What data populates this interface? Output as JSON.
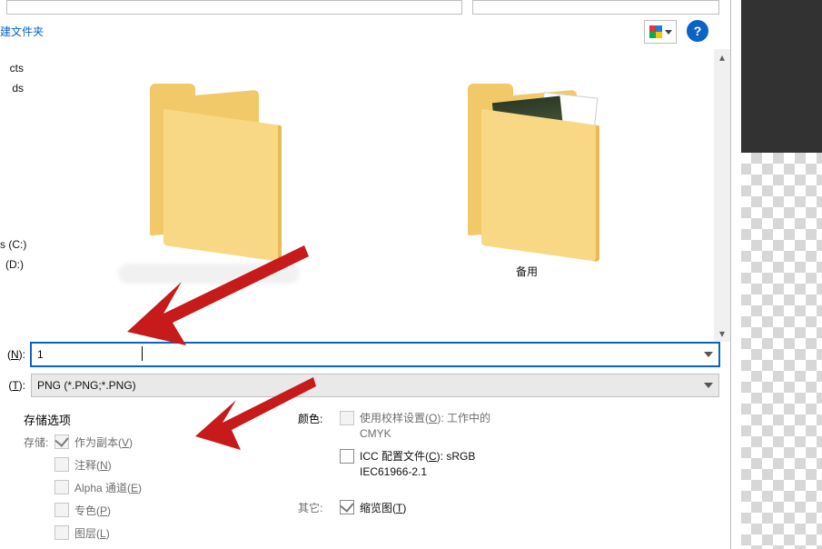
{
  "toolbar": {
    "new_folder_label": "建文件夹",
    "help_glyph": "?"
  },
  "nav": {
    "items": [
      "cts",
      "ds",
      "",
      "s (C:)",
      "(D:)"
    ]
  },
  "content": {
    "folder2_label": "备用"
  },
  "filename": {
    "label_prefix": "(",
    "label_u": "N",
    "label_suffix": "):",
    "value": "1"
  },
  "filetype": {
    "label_prefix": "(",
    "label_u": "T",
    "label_suffix": "):",
    "value": "PNG (*.PNG;*.PNG)"
  },
  "options": {
    "header": "存储选项",
    "save_label": "存储:",
    "as_copy": "作为副本(",
    "as_copy_u": "V",
    "as_copy_end": ")",
    "notes": "注释(",
    "notes_u": "N",
    "notes_end": ")",
    "alpha": "Alpha 通道(",
    "alpha_u": "E",
    "alpha_end": ")",
    "spot": "专色(",
    "spot_u": "P",
    "spot_end": ")",
    "layers": "图层(",
    "layers_u": "L",
    "layers_end": ")",
    "color_label": "颜色:",
    "proof": "使用校样设置(",
    "proof_u": "O",
    "proof_end": "):  工作中的 CMYK",
    "icc": "ICC 配置文件(",
    "icc_u": "C",
    "icc_end": "): sRGB IEC61966-2.1",
    "other_label": "其它:",
    "thumb": "缩览图(",
    "thumb_u": "T",
    "thumb_end": ")"
  }
}
